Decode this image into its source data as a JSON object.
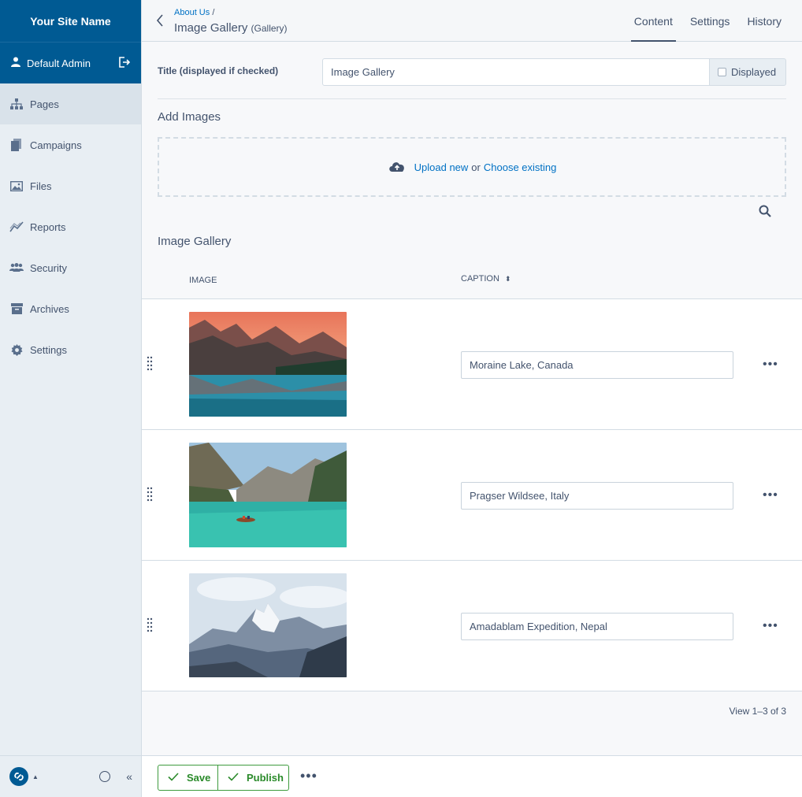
{
  "sidebar": {
    "site_name": "Your Site Name",
    "user": "Default Admin",
    "items": [
      {
        "label": "Pages",
        "icon": "sitemap-icon",
        "active": true
      },
      {
        "label": "Campaigns",
        "icon": "campaigns-icon"
      },
      {
        "label": "Files",
        "icon": "image-icon"
      },
      {
        "label": "Reports",
        "icon": "chart-line-icon"
      },
      {
        "label": "Security",
        "icon": "users-icon"
      },
      {
        "label": "Archives",
        "icon": "archive-icon"
      },
      {
        "label": "Settings",
        "icon": "gear-icon"
      }
    ],
    "collapse_label": "«"
  },
  "header": {
    "breadcrumb": "About Us",
    "breadcrumb_sep": "/",
    "title": "Image Gallery",
    "title_type": "(Gallery)",
    "tabs": [
      {
        "label": "Content",
        "active": true
      },
      {
        "label": "Settings"
      },
      {
        "label": "History"
      }
    ]
  },
  "form": {
    "title_label": "Title (displayed if checked)",
    "title_value": "Image Gallery",
    "displayed_label": "Displayed",
    "displayed_checked": false,
    "add_images_heading": "Add Images",
    "upload_new": "Upload new",
    "or": "or",
    "choose_existing": "Choose existing",
    "gallery_heading": "Image Gallery"
  },
  "table": {
    "col_image": "IMAGE",
    "col_caption": "CAPTION",
    "rows": [
      {
        "caption": "Moraine Lake, Canada",
        "image": "mountain-lake-sunset"
      },
      {
        "caption": "Pragser Wildsee, Italy",
        "image": "turquoise-lake-boat"
      },
      {
        "caption": "Amadablam Expedition, Nepal",
        "image": "snowy-mountain-peak"
      }
    ],
    "pagination": "View 1–3 of 3"
  },
  "footer": {
    "save_label": "Save",
    "publish_label": "Publish"
  },
  "colors": {
    "brand": "#005a93",
    "link": "#0071c4",
    "success": "#2a8a2a",
    "text": "#43536d"
  }
}
